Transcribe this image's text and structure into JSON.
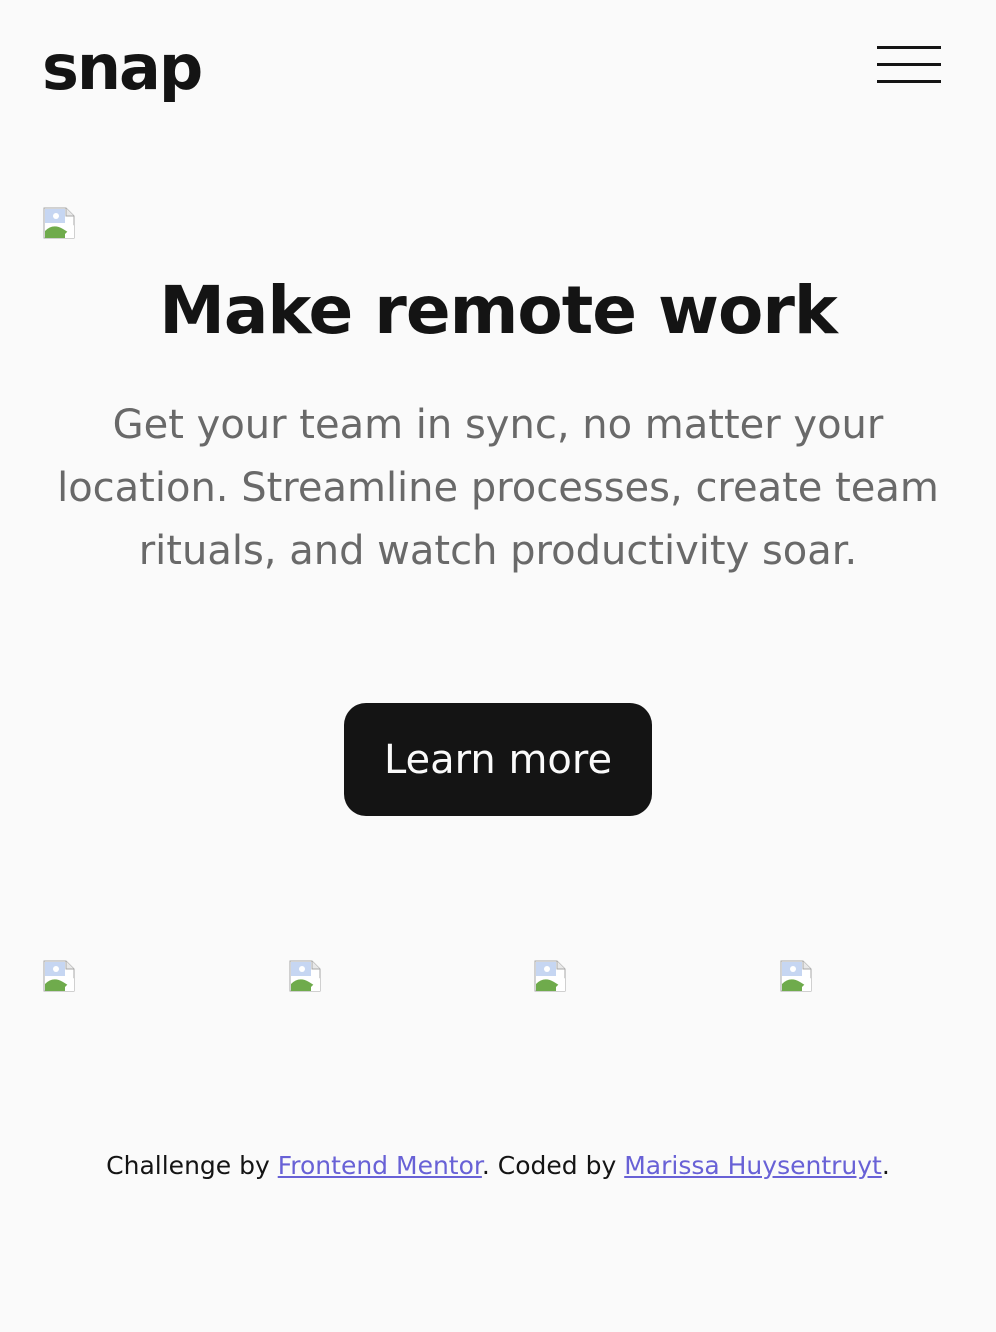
{
  "header": {
    "logo": "snap",
    "menu_icon": "hamburger-menu-icon"
  },
  "hero": {
    "image_icon": "broken-image-icon",
    "headline": "Make remote work",
    "subtext": "Get your team in sync, no matter your location. Streamline processes, create team rituals, and watch productivity soar.",
    "cta_label": "Learn more"
  },
  "clients": {
    "logos": [
      "broken-image-icon",
      "broken-image-icon",
      "broken-image-icon",
      "broken-image-icon"
    ]
  },
  "footer": {
    "prefix": "Challenge by ",
    "link1": "Frontend Mentor",
    "middle": ". Coded by ",
    "link2": "Marissa Huysentruyt",
    "suffix": ".",
    "link_color": "#6861d6"
  },
  "colors": {
    "background": "#fafafa",
    "text_dark": "#141414",
    "text_gray": "#696969",
    "button_bg": "#141414",
    "button_text": "#fafafa"
  }
}
